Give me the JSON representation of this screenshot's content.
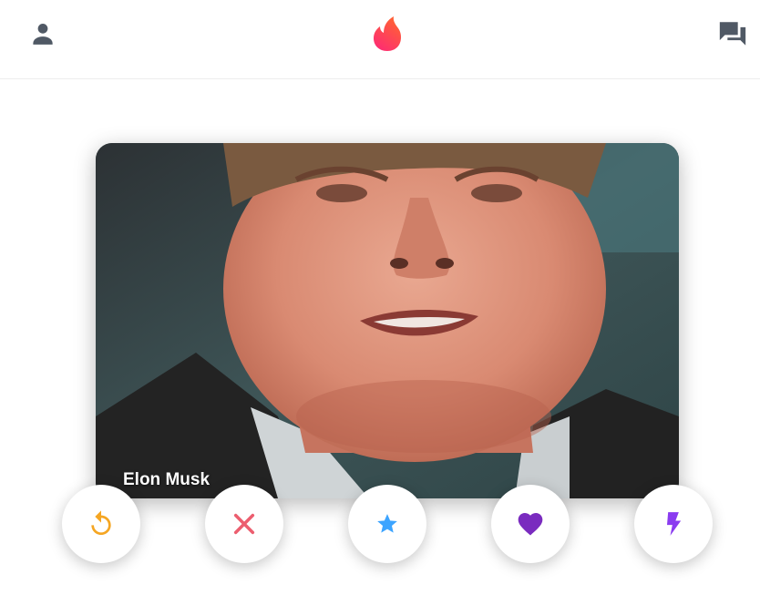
{
  "header": {
    "profile_icon": "person-icon",
    "logo_icon": "flame-logo-icon",
    "messages_icon": "chat-bubbles-icon"
  },
  "card": {
    "name": "Elon Musk"
  },
  "actions": [
    {
      "name": "rewind",
      "icon": "rewind-icon",
      "color": "#f5a623"
    },
    {
      "name": "nope",
      "icon": "close-icon",
      "color": "#ec5e6f"
    },
    {
      "name": "super-like",
      "icon": "star-icon",
      "color": "#3ca4ff"
    },
    {
      "name": "like",
      "icon": "heart-icon",
      "color": "#7a2bbf"
    },
    {
      "name": "boost",
      "icon": "lightning-icon",
      "color": "#8a3cf0"
    }
  ],
  "colors": {
    "brand_gradient_start": "#fd267a",
    "brand_gradient_end": "#ff6036",
    "header_icon": "#505965"
  }
}
